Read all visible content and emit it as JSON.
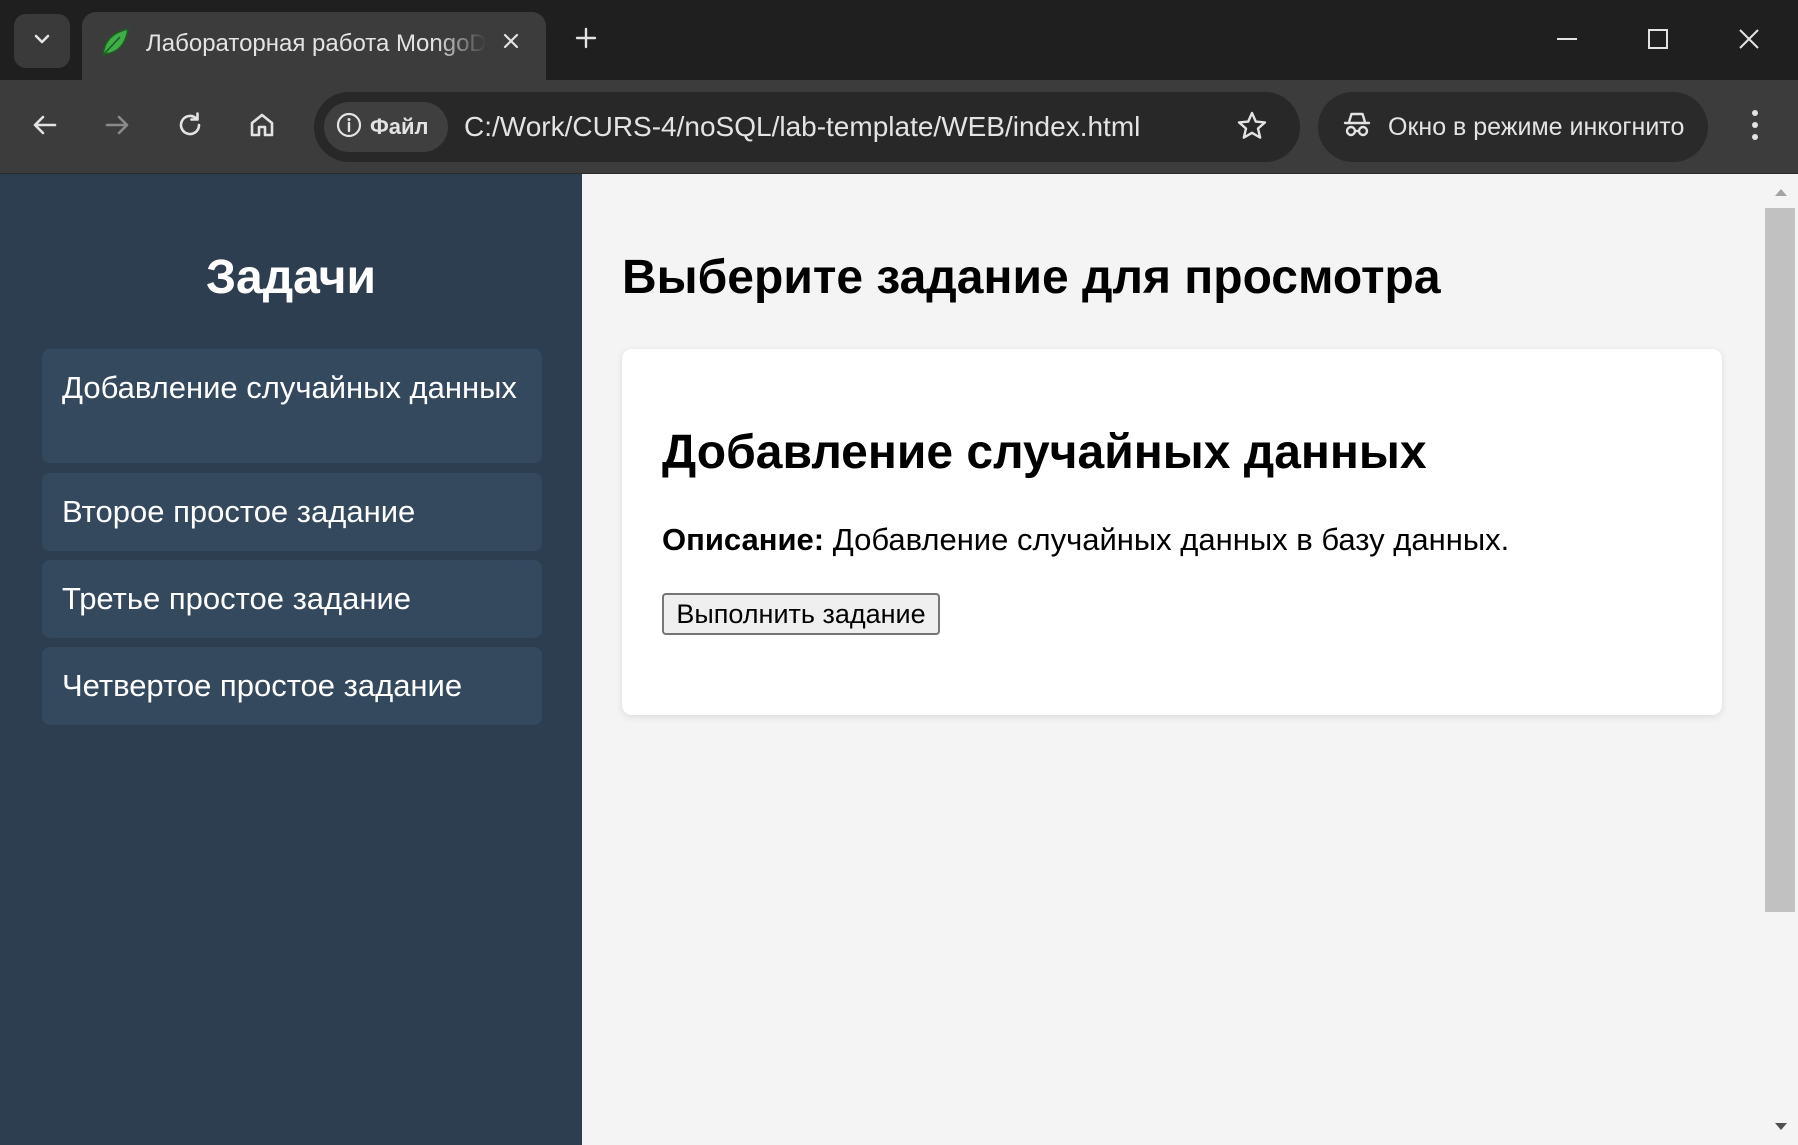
{
  "browser": {
    "tab": {
      "title": "Лабораторная работа MongoDB",
      "favicon": "mongodb-leaf-icon"
    },
    "address_bar": {
      "site_info_label": "Файл",
      "url": "C:/Work/CURS-4/noSQL/lab-template/WEB/index.html"
    },
    "incognito_label": "Окно в режиме инкогнито",
    "icons": {
      "tab_search": "chevron-down-icon",
      "close_tab": "close-icon",
      "new_tab": "plus-icon",
      "minimize": "minimize-icon",
      "maximize": "maximize-icon",
      "close_window": "close-icon",
      "back": "arrow-left-icon",
      "forward": "arrow-right-icon",
      "reload": "reload-icon",
      "home": "home-icon",
      "info": "info-icon",
      "bookmark": "star-icon",
      "incognito": "incognito-icon",
      "menu": "kebab-menu-icon"
    }
  },
  "page": {
    "sidebar": {
      "title": "Задачи",
      "items": [
        {
          "label": "Добавление случайных данных"
        },
        {
          "label": "Второе простое задание"
        },
        {
          "label": "Третье простое задание"
        },
        {
          "label": "Четвертое простое задание"
        }
      ]
    },
    "main": {
      "title": "Выберите задание для просмотра",
      "task": {
        "title": "Добавление случайных данных",
        "description_label": "Описание:",
        "description": "Добавление случайных данных в базу данных.",
        "run_button": "Выполнить задание"
      }
    }
  },
  "colors": {
    "sidebar_bg": "#2c3e50",
    "sidebar_item_bg": "#34495e",
    "content_bg": "#f4f4f4",
    "card_bg": "#ffffff",
    "browser_frame": "#1f1f1f",
    "toolbar": "#3c3c3c"
  }
}
